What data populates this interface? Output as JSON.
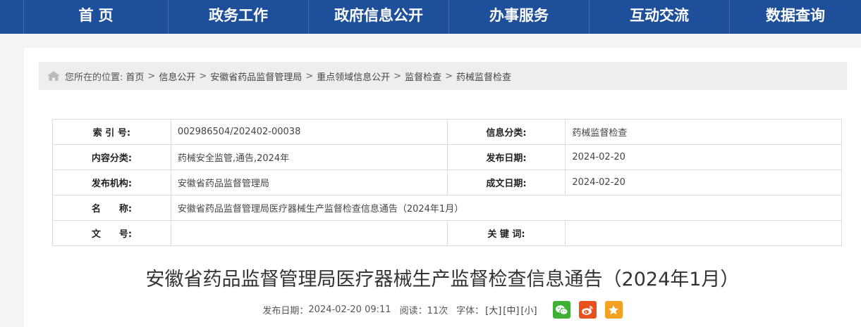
{
  "nav": {
    "items": [
      "首 页",
      "政务工作",
      "政府信息公开",
      "办事服务",
      "互动交流",
      "数据查询"
    ]
  },
  "breadcrumb": {
    "prefix": "您所在的位置:",
    "items": [
      "首页",
      "信息公开",
      "安徽省药品监督管理局",
      "重点领域信息公开",
      "监督检查",
      "药械监督检查"
    ],
    "separator": ">"
  },
  "meta": {
    "index_label": "索 引 号:",
    "index_value": "002986504/202402-00038",
    "category_label": "信息分类:",
    "category_value": "药械监督检查",
    "content_label": "内容分类:",
    "content_value": "药械安全监管,通告,2024年",
    "publish_date_label": "发布日期:",
    "publish_date_value": "2024-02-20",
    "org_label": "发布机构:",
    "org_value": "安徽省药品监督管理局",
    "created_date_label": "成文日期:",
    "created_date_value": "2024-02-20",
    "name_label": "名　　称:",
    "name_value": "安徽省药品监督管理局医疗器械生产监督检查信息通告（2024年1月）",
    "docno_label": "文　　号:",
    "docno_value": "",
    "keywords_label": "关 键 词:",
    "keywords_value": ""
  },
  "article": {
    "title": "安徽省药品监督管理局医疗器械生产监督检查信息通告（2024年1月）",
    "publish_label": "发布日期：",
    "publish_time": "2024-02-20 09:11",
    "reads_label": "阅读：",
    "reads": "11次",
    "font_label": "字体：",
    "font_large": "[大]",
    "font_medium": "[中]",
    "font_small": "[小]"
  },
  "colors": {
    "nav_bg": "#1d4f9a",
    "wechat": "#3eb135",
    "weibo": "#e8511b",
    "favorite": "#f4a020"
  },
  "icons": [
    "home-icon",
    "wechat-icon",
    "weibo-icon",
    "favorite-star-icon"
  ]
}
